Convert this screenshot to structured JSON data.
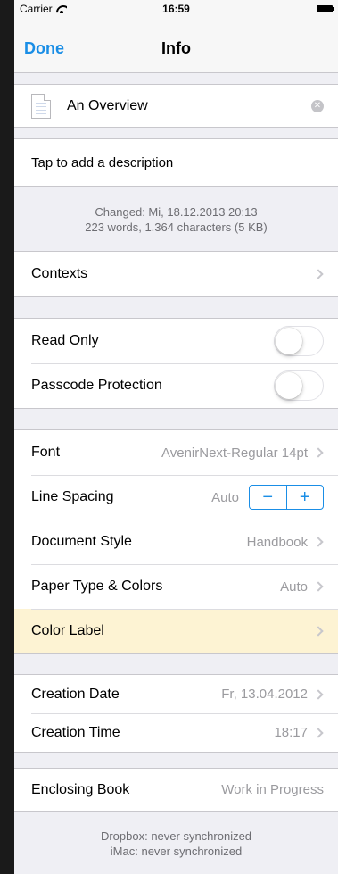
{
  "status": {
    "carrier": "Carrier",
    "time": "16:59"
  },
  "nav": {
    "done": "Done",
    "title": "Info"
  },
  "document": {
    "name": "An Overview",
    "description_placeholder": "Tap to add a description"
  },
  "stats": {
    "changed": "Changed: Mi, 18.12.2013 20:13",
    "counts": "223 words, 1.364 characters (5 KB)"
  },
  "rows": {
    "contexts": "Contexts",
    "read_only": "Read Only",
    "passcode": "Passcode Protection",
    "font": {
      "label": "Font",
      "value": "AvenirNext-Regular 14pt"
    },
    "line_spacing": {
      "label": "Line Spacing",
      "value": "Auto",
      "minus": "−",
      "plus": "+"
    },
    "document_style": {
      "label": "Document Style",
      "value": "Handbook"
    },
    "paper_type": {
      "label": "Paper Type & Colors",
      "value": "Auto"
    },
    "color_label": {
      "label": "Color Label",
      "bg": "#fdf3d3"
    },
    "creation_date": {
      "label": "Creation Date",
      "value": "Fr, 13.04.2012"
    },
    "creation_time": {
      "label": "Creation Time",
      "value": "18:17"
    },
    "enclosing_book": {
      "label": "Enclosing Book",
      "value": "Work in Progress"
    }
  },
  "sync": {
    "dropbox": "Dropbox: never synchronized",
    "imac": "iMac: never synchronized"
  },
  "colors": {
    "accent": "#1a8ee6"
  }
}
